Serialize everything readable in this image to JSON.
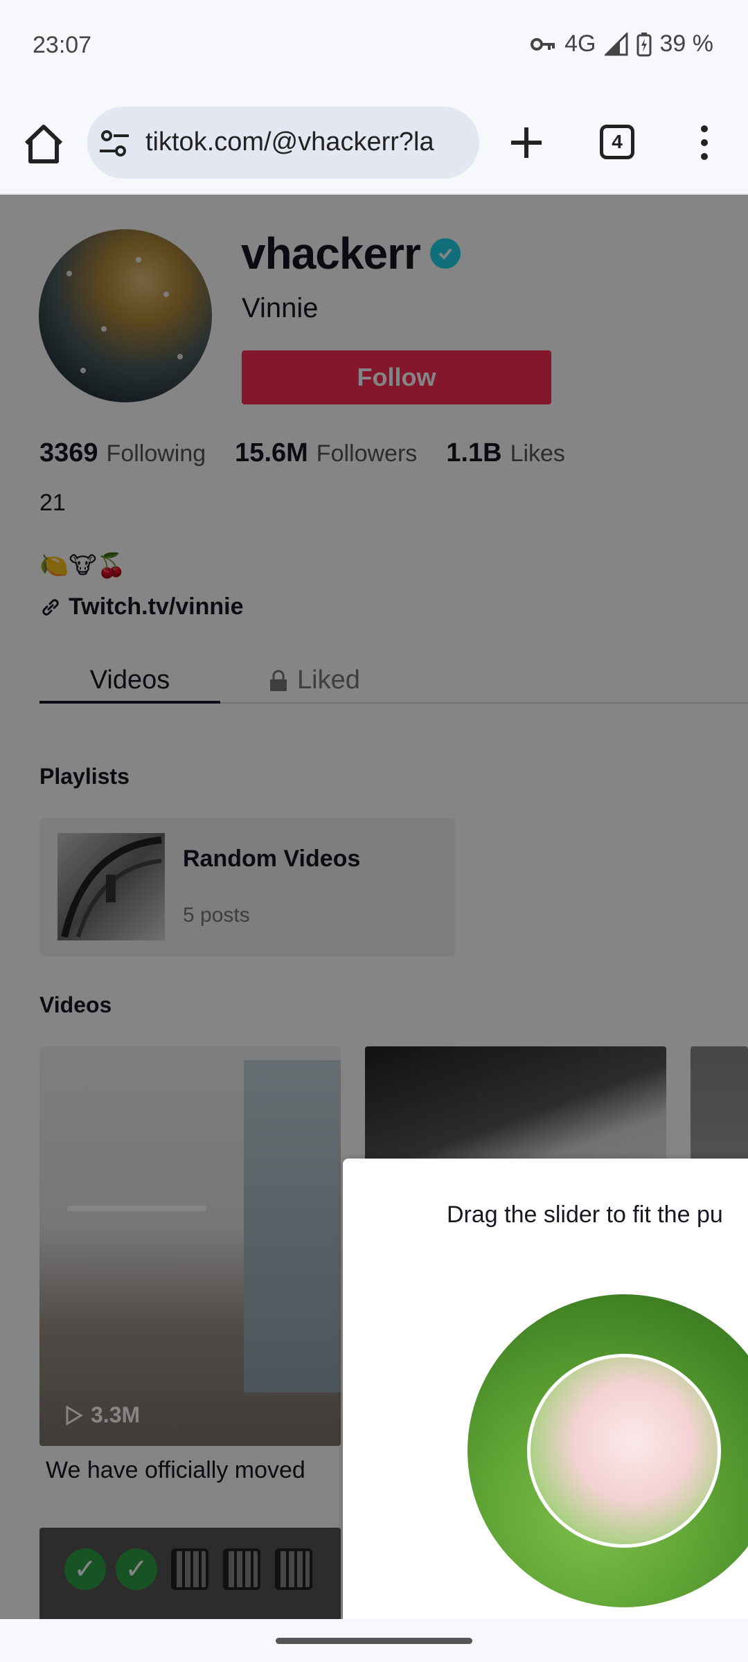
{
  "status_bar": {
    "time": "23:07",
    "network": "4G",
    "battery": "39 %"
  },
  "browser": {
    "url": "tiktok.com/@vhackerr?la",
    "tab_count": "4"
  },
  "profile": {
    "username": "vhackerr",
    "nickname": "Vinnie",
    "follow_label": "Follow",
    "stats": [
      {
        "value": "3369",
        "label": "Following"
      },
      {
        "value": "15.6M",
        "label": "Followers"
      },
      {
        "value": "1.1B",
        "label": "Likes"
      }
    ],
    "bio_line1": "21",
    "bio_line2": "🍋🐮🍒",
    "link": "Twitch.tv/vinnie"
  },
  "tabs": {
    "videos": "Videos",
    "liked": "Liked"
  },
  "playlists": {
    "heading": "Playlists",
    "items": [
      {
        "title": "Random Videos",
        "count": "5 posts"
      }
    ]
  },
  "videos": {
    "heading": "Videos",
    "items": [
      {
        "views": "3.3M",
        "caption": "We have officially moved"
      }
    ]
  },
  "captcha": {
    "prompt": "Drag the slider to fit the pu"
  }
}
